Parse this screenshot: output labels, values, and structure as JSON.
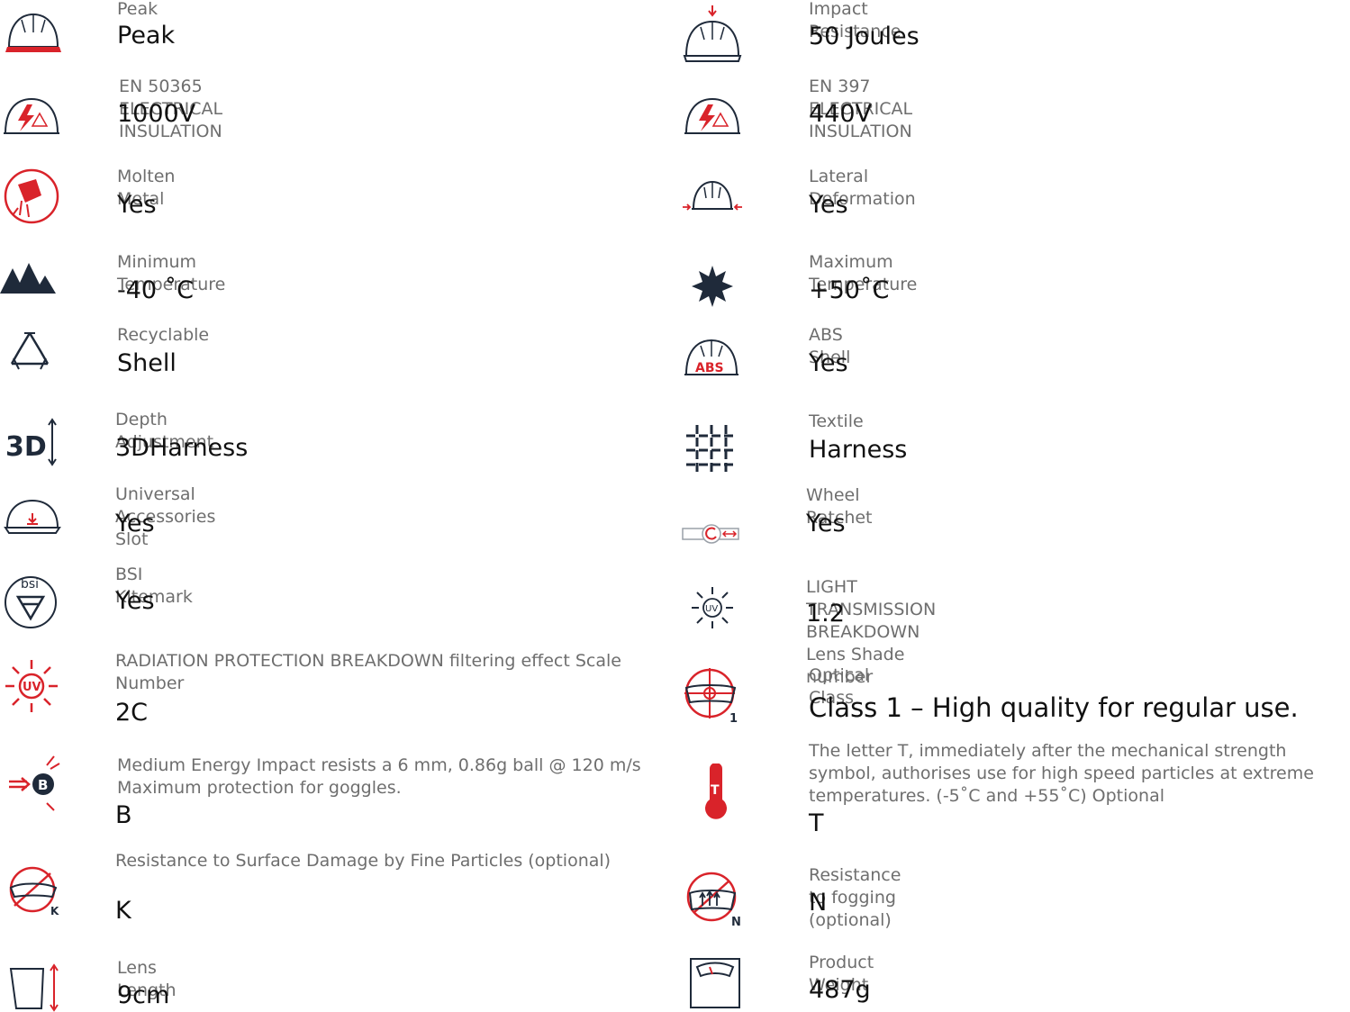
{
  "colors": {
    "accent": "#d9232a",
    "icon": "#1f2a3a",
    "label": "#6e6e6e",
    "value": "#111111"
  },
  "left": [
    {
      "icon": "helmet-peak-icon",
      "label": "Peak",
      "value": "Peak"
    },
    {
      "icon": "electrical-insulation-icon",
      "label": "EN 50365 ELECTRICAL INSULATION",
      "value": "1000V"
    },
    {
      "icon": "molten-metal-icon",
      "label": "Molten Metal",
      "value": "Yes"
    },
    {
      "icon": "mountains-icon",
      "label": "Minimum Temperature",
      "value": "-40 ˚C"
    },
    {
      "icon": "recycle-icon",
      "label": "Recyclable",
      "value": "Shell"
    },
    {
      "icon": "3d-harness-icon",
      "label": "Depth Adjustment",
      "value": "3DHarness"
    },
    {
      "icon": "accessory-slot-icon",
      "label": "Universal Accessories Slot",
      "value": "Yes"
    },
    {
      "icon": "bsi-kitemark-icon",
      "label": "BSI Kitemark",
      "value": "Yes"
    },
    {
      "icon": "uv-radiation-icon",
      "label": "RADIATION PROTECTION BREAKDOWN filtering effect Scale Number",
      "value": "2C"
    },
    {
      "icon": "impact-b-icon",
      "label": "Medium Energy Impact resists a 6 mm, 0.86g ball @ 120 m/s Maximum protection for goggles.",
      "value": "B"
    },
    {
      "icon": "surface-damage-k-icon",
      "label": "Resistance to Surface Damage by Fine Particles (optional)",
      "value": "K"
    },
    {
      "icon": "lens-length-icon",
      "label": "Lens Length",
      "value": "9cm"
    }
  ],
  "right": [
    {
      "icon": "impact-resistance-icon",
      "label": "Impact Resistance",
      "value": "50 Joules"
    },
    {
      "icon": "electrical-insulation-icon",
      "label": "EN 397 ELECTRICAL INSULATION",
      "value": "440V"
    },
    {
      "icon": "lateral-deformation-icon",
      "label": "Lateral Deformation",
      "value": "Yes"
    },
    {
      "icon": "sun-icon",
      "label": "Maximum Temperature",
      "value": "+50˚C"
    },
    {
      "icon": "abs-shell-icon",
      "label": "ABS Shell",
      "value": "Yes",
      "badge": "ABS"
    },
    {
      "icon": "textile-icon",
      "label": "Textile",
      "value": "Harness"
    },
    {
      "icon": "wheel-ratchet-icon",
      "label": "Wheel Ratchet",
      "value": "Yes"
    },
    {
      "icon": "uv-light-icon",
      "label": "LIGHT TRANSMISSION BREAKDOWN Lens Shade number",
      "value": "1.2",
      "badge": "UV"
    },
    {
      "icon": "optical-class-icon",
      "label": "Optical Class",
      "value": "Class 1 – High quality for regular use.",
      "badge": "1"
    },
    {
      "icon": "thermometer-t-icon",
      "label": "The letter T, immediately after the mechanical strength symbol, authorises use for high speed particles at extreme temperatures. (-5˚C and +55˚C) Optional",
      "value": "T",
      "badge": "T"
    },
    {
      "icon": "anti-fog-n-icon",
      "label": "Resistance to fogging (optional)",
      "value": "N"
    },
    {
      "icon": "weight-scale-icon",
      "label": "Product Weight",
      "value": "487g"
    }
  ],
  "icon_text": {
    "bsi": "bsi",
    "uv": "UV",
    "b": "B",
    "k": "K",
    "n": "N",
    "3d": "3D"
  }
}
